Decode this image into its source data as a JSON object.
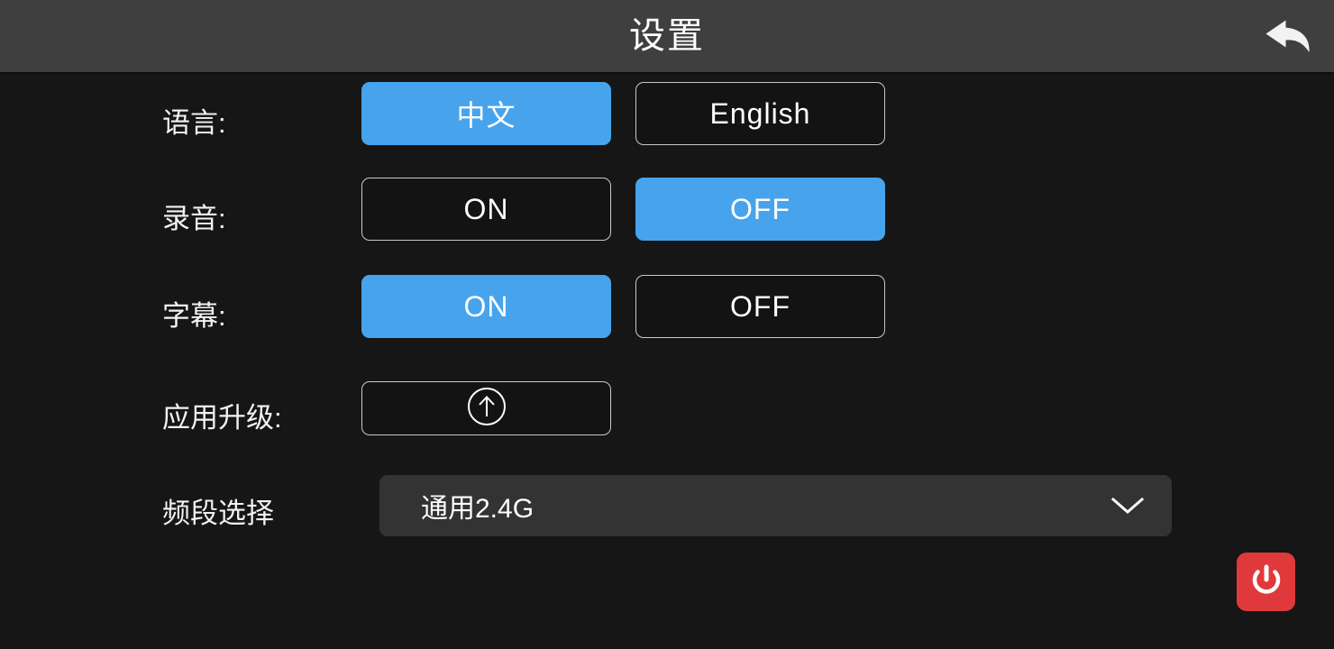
{
  "header": {
    "title": "设置",
    "back_icon": "back-arrow-icon"
  },
  "settings": {
    "rows": [
      {
        "label": "语言:",
        "type": "toggle",
        "options": [
          {
            "label": "中文",
            "selected": true
          },
          {
            "label": "English",
            "selected": false
          }
        ]
      },
      {
        "label": "录音:",
        "type": "toggle",
        "options": [
          {
            "label": "ON",
            "selected": false
          },
          {
            "label": "OFF",
            "selected": true
          }
        ]
      },
      {
        "label": "字幕:",
        "type": "toggle",
        "options": [
          {
            "label": "ON",
            "selected": true
          },
          {
            "label": "OFF",
            "selected": false
          }
        ]
      },
      {
        "label": "应用升级:",
        "type": "action",
        "icon": "upload-circle-arrow-icon"
      },
      {
        "label": "频段选择",
        "type": "dropdown",
        "value": "通用2.4G",
        "caret_icon": "chevron-down-icon"
      }
    ]
  },
  "power": {
    "icon": "power-icon"
  },
  "colors": {
    "accent_blue": "#47a4ec",
    "header_bg": "#403f3f",
    "page_bg": "#161616",
    "dropdown_bg": "#333333",
    "power_red": "#e0393b",
    "border_light": "#c9c9c9",
    "text_primary": "#ffffff"
  }
}
